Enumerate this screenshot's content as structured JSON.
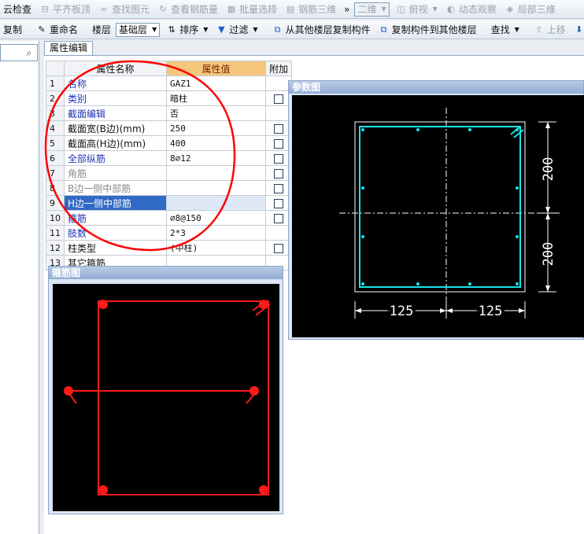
{
  "toolbar1": {
    "items": [
      {
        "label": "云检查",
        "icon": "cloud-check-icon",
        "disabled": false
      },
      {
        "label": "平齐板顶",
        "icon": "align-top-icon",
        "disabled": true
      },
      {
        "label": "查找图元",
        "icon": "binoculars-icon",
        "disabled": true
      },
      {
        "label": "查看钢筋量",
        "icon": "view-rebar-icon",
        "disabled": true
      },
      {
        "label": "批量选择",
        "icon": "batch-select-icon",
        "disabled": true
      },
      {
        "label": "钢筋三维",
        "icon": "rebar-3d-icon",
        "disabled": true
      }
    ],
    "overflow": "»",
    "view_mode": "二维",
    "view_items": [
      {
        "label": "俯视",
        "icon": "top-view-icon"
      },
      {
        "label": "动态观察",
        "icon": "orbit-icon"
      },
      {
        "label": "局部三维",
        "icon": "local-3d-icon"
      }
    ]
  },
  "toolbar2": {
    "copy_label": "复制",
    "rename_label": "重命名",
    "floor_label": "楼层",
    "floor_value": "基础层",
    "sort_label": "排序",
    "filter_label": "过滤",
    "copy_from_label": "从其他楼层复制构件",
    "copy_to_label": "复制构件到其他楼层",
    "find_label": "查找",
    "up_label": "上移",
    "down_label": "下移"
  },
  "prop_panel": {
    "tab_label": "属性编辑",
    "header": {
      "name": "属性名称",
      "value": "属性值",
      "add": "附加"
    },
    "rows": [
      {
        "num": "1",
        "name": "名称",
        "value": "GAZ1",
        "style": "blue",
        "checkbox": false
      },
      {
        "num": "2",
        "name": "类别",
        "value": "暗柱",
        "style": "blue",
        "checkbox": true
      },
      {
        "num": "3",
        "name": "截面编辑",
        "value": "否",
        "style": "blue",
        "checkbox": false
      },
      {
        "num": "4",
        "name": "截面宽(B边)(mm)",
        "value": "250",
        "style": "black",
        "checkbox": true
      },
      {
        "num": "5",
        "name": "截面高(H边)(mm)",
        "value": "400",
        "style": "black",
        "checkbox": true
      },
      {
        "num": "6",
        "name": "全部纵筋",
        "value": "8⌀12",
        "style": "blue",
        "checkbox": true
      },
      {
        "num": "7",
        "name": "角筋",
        "value": "",
        "style": "gray",
        "checkbox": true
      },
      {
        "num": "8",
        "name": "B边一侧中部筋",
        "value": "",
        "style": "gray",
        "checkbox": true
      },
      {
        "num": "9",
        "name": "H边一侧中部筋",
        "value": "",
        "style": "selected",
        "checkbox": true
      },
      {
        "num": "10",
        "name": "箍筋",
        "value": "⌀8@150",
        "style": "blue",
        "checkbox": true
      },
      {
        "num": "11",
        "name": "肢数",
        "value": "2*3",
        "style": "blue",
        "checkbox": false
      },
      {
        "num": "12",
        "name": "柱类型",
        "value": "(中柱)",
        "style": "black",
        "checkbox": true
      },
      {
        "num": "13",
        "name": "其它箍筋",
        "value": "",
        "style": "black",
        "checkbox": false
      }
    ]
  },
  "param_window": {
    "title": "参数图",
    "dim_h_top": "200",
    "dim_h_bottom": "200",
    "dim_b_left": "125",
    "dim_b_right": "125",
    "drawing_color": "#19e3e8",
    "dim_color": "#ffffff"
  },
  "stirrup_window": {
    "title": "箍筋图",
    "drawing_color": "#ff1a1a"
  },
  "colors": {
    "annotation": "#ff0000",
    "header_value_bg": "#f5c77c",
    "selected_row": "#316ac5"
  }
}
